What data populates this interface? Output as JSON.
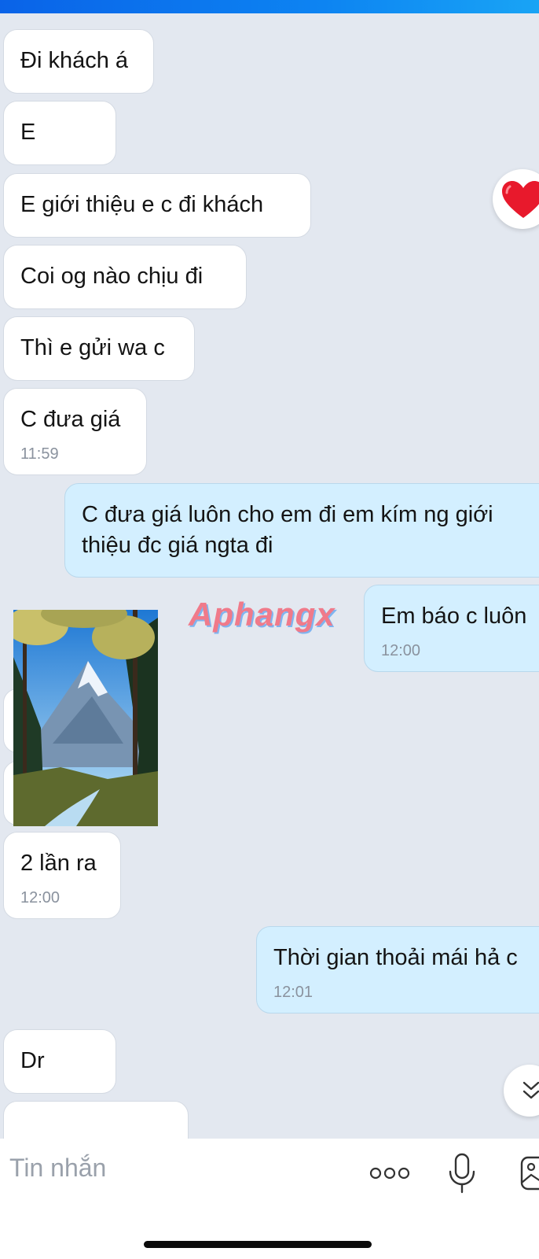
{
  "messages": [
    {
      "side": "in",
      "text": "Đi khách á",
      "time": ""
    },
    {
      "side": "in",
      "text": "E",
      "time": ""
    },
    {
      "side": "in",
      "text": "E giới thiệu e c đi khách",
      "time": ""
    },
    {
      "side": "in",
      "text": "Coi og nào chịu đi",
      "time": ""
    },
    {
      "side": "in",
      "text": "Thì e gửi wa c",
      "time": ""
    },
    {
      "side": "in",
      "text": "C đưa giá",
      "time": "11:59"
    },
    {
      "side": "out",
      "text": "C đưa giá luôn cho em đi em kím ng giới thiệu đc giá ngta đi",
      "time": ""
    },
    {
      "side": "out",
      "text": "Em báo c luôn",
      "time": "12:00"
    },
    {
      "side": "in",
      "text": "2 lần ra",
      "time": "12:00"
    },
    {
      "side": "out",
      "text": "Thời gian thoải mái hả c",
      "time": "12:01"
    },
    {
      "side": "in",
      "text": "Dr",
      "time": ""
    }
  ],
  "reaction": {
    "icon": "heart-icon",
    "color": "#e8192c"
  },
  "watermark": {
    "text": "Aphangx"
  },
  "composer": {
    "placeholder": "Tin nhắn",
    "icons": [
      "more-options-icon",
      "microphone-icon",
      "image-icon"
    ]
  },
  "colors": {
    "incoming_bubble": "#ffffff",
    "outgoing_bubble": "#d3efff",
    "background": "#e3e8f0",
    "accent": "#0a63e8"
  }
}
